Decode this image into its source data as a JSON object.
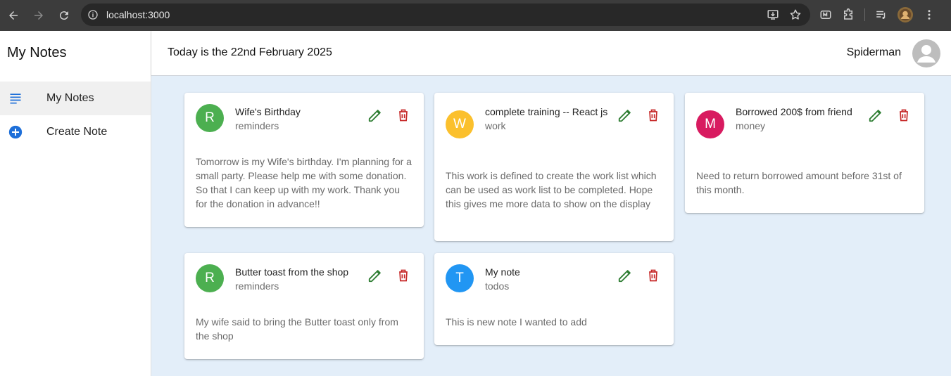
{
  "browser": {
    "url": "localhost:3000"
  },
  "sidebar": {
    "title": "My Notes",
    "items": [
      {
        "label": "My Notes",
        "icon": "notes-list-icon",
        "active": true
      },
      {
        "label": "Create Note",
        "icon": "add-circle-icon",
        "active": false
      }
    ]
  },
  "header": {
    "date_text": "Today is the 22nd February 2025",
    "username": "Spiderman"
  },
  "notes": [
    {
      "initial": "R",
      "title": "Wife's Birthday",
      "category": "reminders",
      "color": "#4caf50",
      "body": "Tomorrow is my Wife's birthday. I'm planning for a small party. Please help me with some donation. So that I can keep up with my work. Thank you for the donation in advance!!"
    },
    {
      "initial": "W",
      "title": "complete training -- React js",
      "category": "work",
      "color": "#fbc02d",
      "body": "This work is defined to create the work list which can be used as work list to be completed. Hope this gives me more data to show on the display"
    },
    {
      "initial": "M",
      "title": "Borrowed 200$ from friend",
      "category": "money",
      "color": "#d81b60",
      "body": "Need to return borrowed amount before 31st of this month."
    },
    {
      "initial": "R",
      "title": "Butter toast from the shop",
      "category": "reminders",
      "color": "#4caf50",
      "body": "My wife said to bring the Butter toast only from the shop"
    },
    {
      "initial": "T",
      "title": "My note",
      "category": "todos",
      "color": "#2196f3",
      "body": "This is new note I wanted to add"
    }
  ],
  "colors": {
    "edit_icon": "#2e7d32",
    "delete_icon": "#c62828",
    "main_background": "#e3eef9",
    "sidebar_icon": "#1e6fd9"
  }
}
